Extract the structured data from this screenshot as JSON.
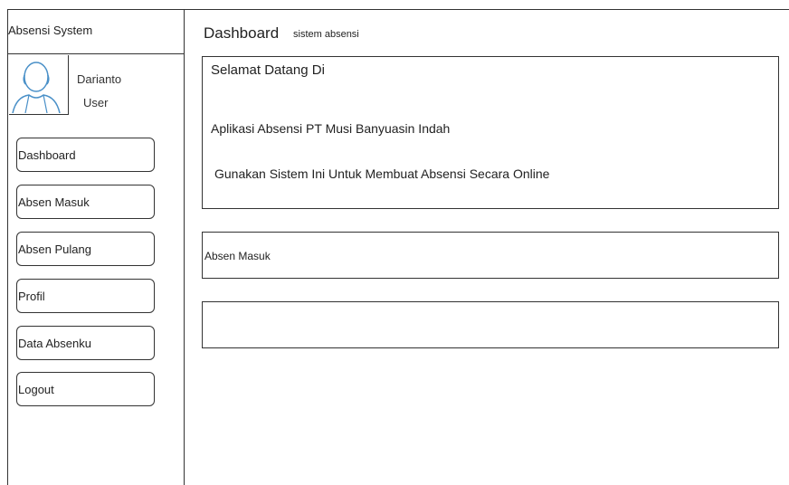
{
  "app": {
    "title": "Absensi System"
  },
  "user": {
    "name": "Darianto",
    "role": "User",
    "avatar_icon": "user-avatar-icon"
  },
  "sidebar": {
    "items": [
      {
        "label": "Dashboard"
      },
      {
        "label": "Absen Masuk"
      },
      {
        "label": "Absen Pulang"
      },
      {
        "label": "Profil"
      },
      {
        "label": "Data Absenku"
      },
      {
        "label": "Logout"
      }
    ]
  },
  "header": {
    "title": "Dashboard",
    "subtitle": "sistem absensi"
  },
  "welcome": {
    "line1": "Selamat Datang Di",
    "line2": "Aplikasi Absensi PT Musi Banyuasin Indah",
    "line3": "Gunakan Sistem Ini Untuk Membuat Absensi Secara Online"
  },
  "panels": {
    "absen_masuk_label": "Absen Masuk",
    "empty_panel": ""
  }
}
